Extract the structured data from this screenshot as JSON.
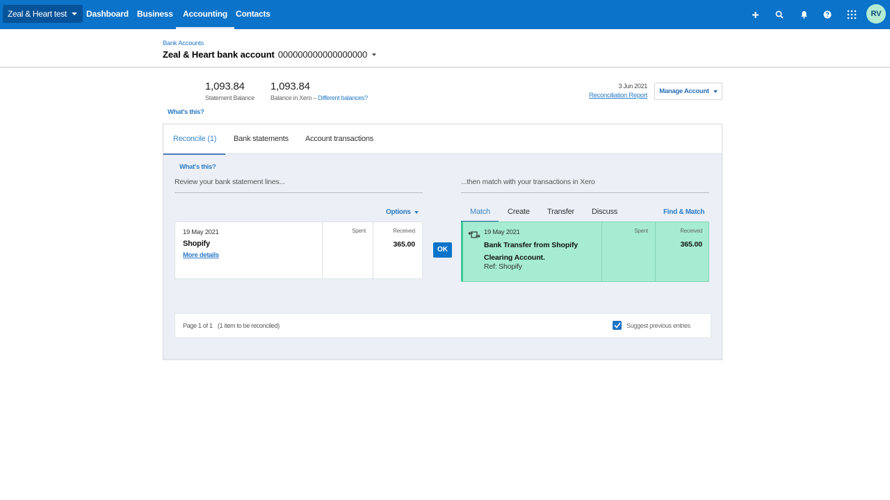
{
  "topnav": {
    "org_name": "Zeal & Heart test",
    "items": [
      {
        "label": "Dashboard",
        "active": false
      },
      {
        "label": "Business",
        "active": false
      },
      {
        "label": "Accounting",
        "active": true
      },
      {
        "label": "Contacts",
        "active": false
      }
    ],
    "icons": [
      "plus-icon",
      "search-icon",
      "bell-icon",
      "help-icon",
      "apps-grid-icon"
    ],
    "avatar_initials": "RV",
    "brand_color": "#0b73c9"
  },
  "header": {
    "breadcrumb": "Bank Accounts",
    "account_name": "Zeal & Heart bank account",
    "account_number": "000000000000000000"
  },
  "balances": {
    "statement_balance": "1,093.84",
    "statement_label": "Statement Balance",
    "xero_balance": "1,093.84",
    "xero_label": "Balance in Xero",
    "separator": " – ",
    "different_link": "Different balances?",
    "whats_this": "What's this?",
    "recon_date": "3 Jun 2021",
    "recon_report": "Reconciliation Report",
    "manage_account": "Manage Account"
  },
  "tabs": [
    {
      "label": "Reconcile (1)",
      "active": true
    },
    {
      "label": "Bank statements",
      "active": false
    },
    {
      "label": "Account transactions",
      "active": false
    }
  ],
  "reconcile": {
    "whats_this": "What's this?",
    "left_heading": "Review your bank statement lines...",
    "right_heading": "...then match with your transactions in Xero",
    "options_label": "Options",
    "statement_line": {
      "date": "19 May 2021",
      "payee": "Shopify",
      "more_details": "More details",
      "spent_label": "Spent",
      "spent_value": "",
      "received_label": "Received",
      "received_value": "365.00"
    },
    "ok_label": "OK",
    "match_tabs": [
      {
        "label": "Match",
        "active": true
      },
      {
        "label": "Create",
        "active": false
      },
      {
        "label": "Transfer",
        "active": false
      },
      {
        "label": "Discuss",
        "active": false
      }
    ],
    "find_match": "Find & Match",
    "match_line": {
      "icon": "transfer-icon",
      "date": "19 May 2021",
      "description": "Bank Transfer from Shopify Clearing Account.",
      "ref": "Ref: Shopify",
      "spent_label": "Spent",
      "spent_value": "",
      "received_label": "Received",
      "received_value": "365.00",
      "highlight_color": "#a6ecd3"
    },
    "footer": {
      "page": "Page 1 of 1",
      "items_note": "(1 item to be reconciled)",
      "suggest_label": "Suggest previous entries",
      "suggest_checked": true
    }
  }
}
